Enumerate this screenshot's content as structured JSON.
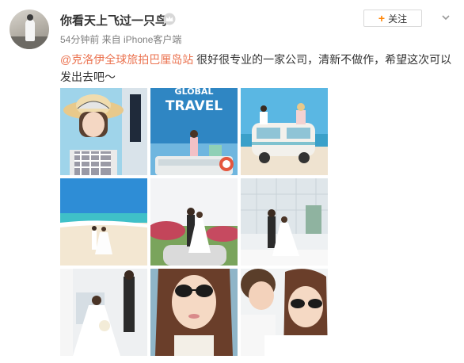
{
  "post": {
    "username": "你看天上飞过一只鸟",
    "meta": "54分钟前 来自 iPhone客户端",
    "follow_label": "关注",
    "mention": "@克洛伊全球旅拍巴厘岛站",
    "text": " 很好很专业的一家公司，清新不做作，希望这次可以发出去吧～"
  },
  "photos": {
    "travel_banner_line1": "GLOBAL",
    "travel_banner_line2": "TRAVEL"
  },
  "icons": {
    "vip": "crown-icon",
    "follow": "plus-icon",
    "menu": "chevron-down-icon"
  },
  "colors": {
    "mention": "#eb7350",
    "accent": "#ff8200",
    "meta": "#808080"
  }
}
